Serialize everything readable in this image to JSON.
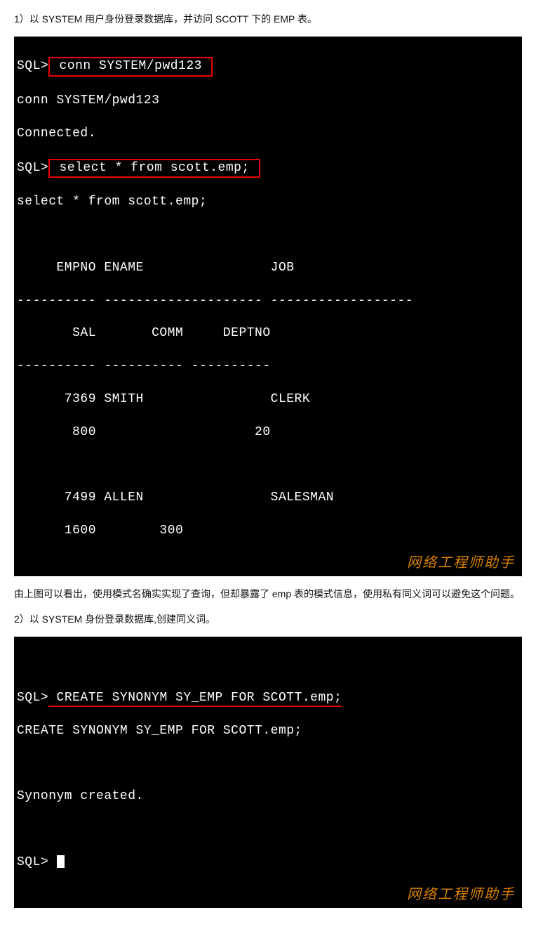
{
  "step1_text": "1）以 SYSTEM 用户身份登录数据库，并访问 SCOTT 下的 EMP 表。",
  "terminal1": {
    "prompt1": "SQL>",
    "cmd1": " conn SYSTEM/pwd123 ",
    "echo1": "conn SYSTEM/pwd123",
    "connected": "Connected.",
    "prompt2": "SQL>",
    "cmd2": " select * from scott.emp; ",
    "echo2": "select * from scott.emp;",
    "blank1": " ",
    "header1": "     EMPNO ENAME                JOB",
    "divider1": "---------- -------------------- ------------------",
    "header2": "       SAL       COMM     DEPTNO",
    "divider2": "---------- ---------- ----------",
    "row1a": "      7369 SMITH                CLERK",
    "row1b": "       800                    20",
    "blank2": " ",
    "row2a": "      7499 ALLEN                SALESMAN",
    "row2b": "      1600        300",
    "watermark": "网络工程师助手"
  },
  "middle_text": "由上图可以看出，使用模式名确实实现了查询，但却暴露了 emp 表的模式信息，使用私有同义词可以避免这个问题。",
  "step2_text": "2）以 SYSTEM 身份登录数据库,创建同义词。",
  "terminal2": {
    "blank0": " ",
    "prompt1": "SQL>",
    "cmd1": " CREATE SYNONYM SY_EMP FOR SCOTT.emp;",
    "echo1": "CREATE SYNONYM SY_EMP FOR SCOTT.emp;",
    "blank1": " ",
    "result": "Synonym created.",
    "blank2": " ",
    "prompt2": "SQL> ",
    "watermark": "网络工程师助手"
  }
}
